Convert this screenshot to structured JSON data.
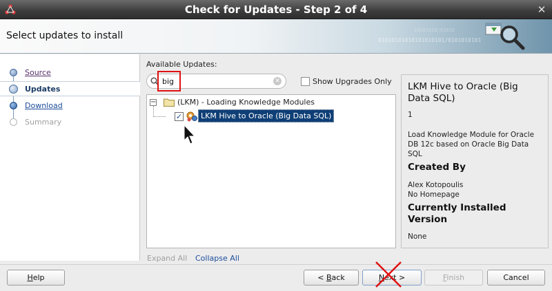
{
  "window": {
    "title": "Check for Updates - Step 2 of 4",
    "close_glyph": "✕"
  },
  "header": {
    "heading": "Select updates to install",
    "decor_binary": "01010101010101010101/0101010101",
    "decor_binary2": "10101010/01010"
  },
  "steps": [
    {
      "label": "Source",
      "state": "done"
    },
    {
      "label": "Updates",
      "state": "current"
    },
    {
      "label": "Download",
      "state": "link"
    },
    {
      "label": "Summary",
      "state": "disabled"
    }
  ],
  "available": {
    "label": "Available Updates:",
    "search_value": "big",
    "show_upgrades_label": "Show Upgrades Only",
    "show_upgrades_checked": false
  },
  "tree": {
    "category_label": "(LKM) - Loading Knowledge Modules",
    "expander_glyph": "−",
    "item_label": "LKM Hive to Oracle (Big Data SQL)",
    "item_checked": true,
    "check_glyph": "✓"
  },
  "tree_actions": {
    "expand_all": "Expand All",
    "collapse_all": "Collapse All"
  },
  "details": {
    "title": "LKM Hive to Oracle (Big Data SQL)",
    "version": "1",
    "description": "Load Knowledge Module for Oracle DB 12c based on Oracle Big Data SQL",
    "created_by_heading": "Created By",
    "author": "Alex Kotopoulis",
    "homepage": "No Homepage",
    "installed_heading": "Currently Installed Version",
    "installed_value": "None"
  },
  "buttons": {
    "help": {
      "mnemonic": "H",
      "rest": "elp"
    },
    "back": {
      "prefix": "< ",
      "mnemonic": "B",
      "rest": "ack"
    },
    "next": {
      "mnemonic": "N",
      "rest": "ext >"
    },
    "finish": {
      "mnemonic": "F",
      "rest": "inish"
    },
    "cancel": "Cancel"
  },
  "colors": {
    "highlight_box": "#e01010",
    "selection": "#0f3f76",
    "link": "#1b4c9b"
  }
}
